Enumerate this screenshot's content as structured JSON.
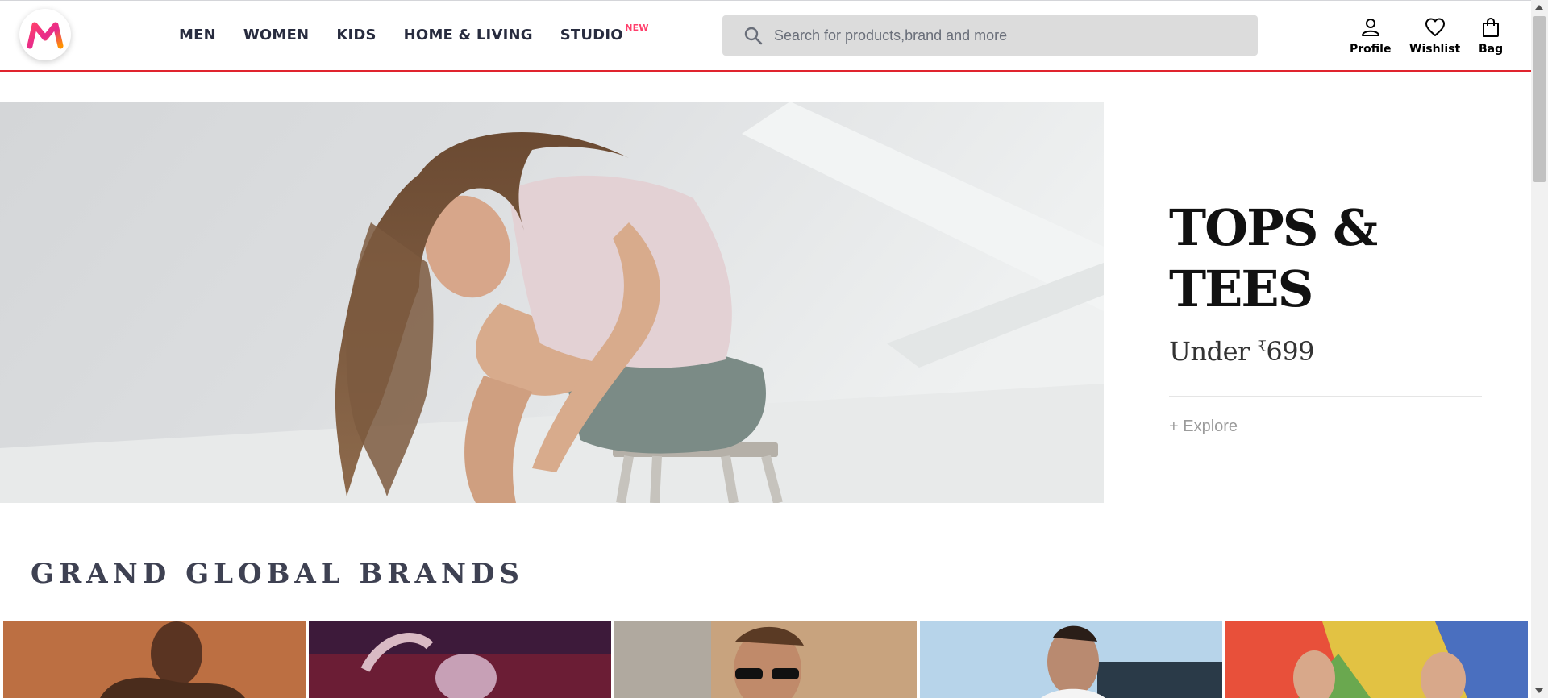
{
  "brand": {
    "logo_letter": "M",
    "colors": {
      "accent": "#ff3f6c",
      "header_border": "#e0242e",
      "logo_orange": "#ff9100"
    }
  },
  "nav": {
    "items": [
      {
        "label": "MEN"
      },
      {
        "label": "WOMEN"
      },
      {
        "label": "KIDS"
      },
      {
        "label": "HOME & LIVING"
      },
      {
        "label": "STUDIO",
        "badge": "NEW"
      }
    ]
  },
  "search": {
    "placeholder": "Search for products,brand and more",
    "icon": "search-icon"
  },
  "actions": [
    {
      "label": "Profile",
      "icon": "profile-icon"
    },
    {
      "label": "Wishlist",
      "icon": "heart-icon"
    },
    {
      "label": "Bag",
      "icon": "bag-icon"
    }
  ],
  "hero": {
    "title": "TOPS & TEES",
    "sub_prefix": "Under ",
    "currency": "₹",
    "price": "699",
    "cta": "+ Explore"
  },
  "section": {
    "title": "GRAND GLOBAL BRANDS"
  }
}
